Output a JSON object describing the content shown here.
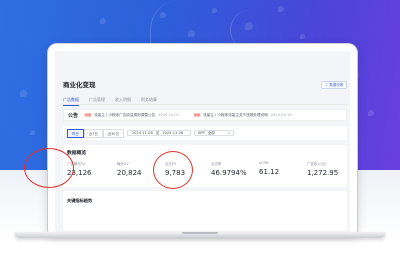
{
  "page": {
    "title": "商业化变现",
    "corner_button": "数据说明",
    "tabs": [
      "广告数据",
      "广告管理",
      "收入明细",
      "财务结算"
    ],
    "active_tab": 0
  },
  "notice": {
    "title": "公告",
    "items": [
      {
        "tag": "重要",
        "text": "流量主丨小程序广告收益规则调整公告",
        "date": "2024-10-01"
      },
      {
        "tag": "重要",
        "text": "流量主丨小程序流量主关于违规处理说明",
        "date": "2024-09-18"
      }
    ]
  },
  "filter": {
    "segments": [
      "昨日",
      "近7日",
      "近30日"
    ],
    "active_segment": 0,
    "date_start": "2024-11-08",
    "date_sep": "至",
    "date_end": "2024-11-08",
    "app_label": "APP",
    "app_value": "全部"
  },
  "stats": {
    "title": "数据概览",
    "metrics": [
      {
        "label": "广告曝光PV",
        "value": "23,126"
      },
      {
        "label": "曝光UV",
        "value": "20,824"
      },
      {
        "label": "点击PV",
        "value": "9,783"
      },
      {
        "label": "点击率",
        "value": "46.9794%"
      },
      {
        "label": "eCPM",
        "value": "61.12"
      },
      {
        "label": "广告收入(元)",
        "value": "1,272.95"
      }
    ]
  },
  "trend": {
    "title": "关键指标趋势"
  },
  "colors": {
    "brand": "#2f5bd3",
    "highlight_circle": "#e0312a"
  }
}
